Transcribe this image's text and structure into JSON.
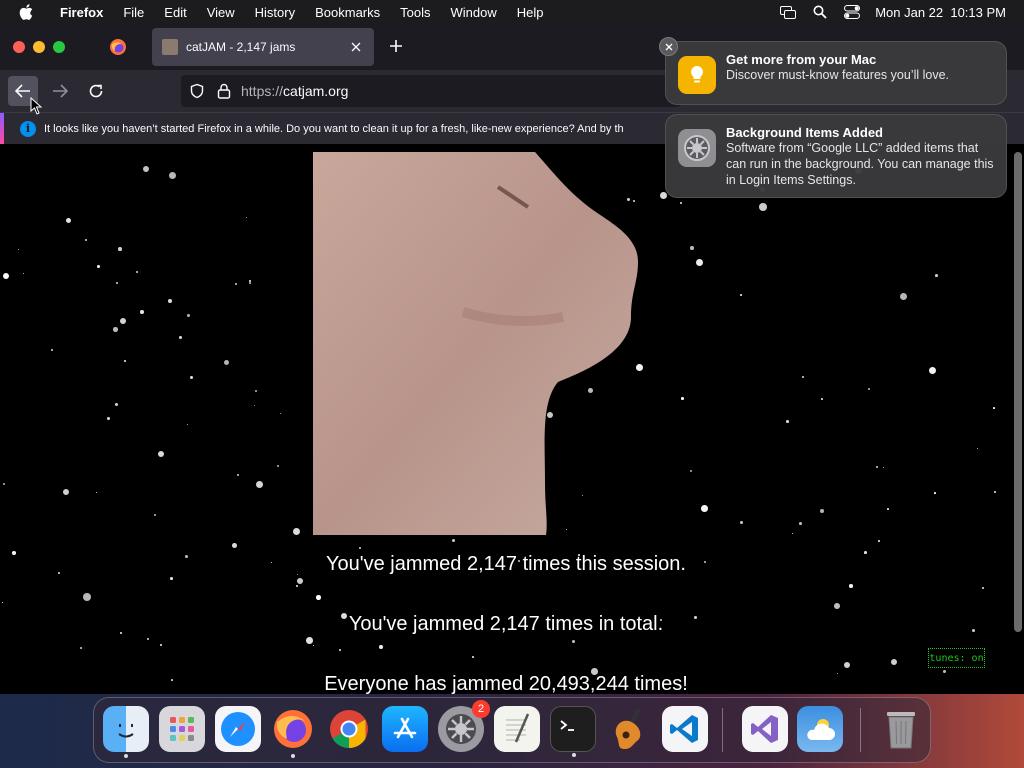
{
  "menubar": {
    "app_name": "Firefox",
    "items": [
      "File",
      "Edit",
      "View",
      "History",
      "Bookmarks",
      "Tools",
      "Window",
      "Help"
    ],
    "clock": "Mon Jan 22  10:13 PM",
    "status_icons": [
      "screen-mirroring-icon",
      "spotlight-icon",
      "control-center-icon"
    ]
  },
  "browser": {
    "tab_title": "catJAM - 2,147 jams",
    "url_scheme": "https://",
    "url_host": "catjam.org",
    "infobar_message": "It looks like you haven’t started Firefox in a while. Do you want to clean it up for a fresh, like-new experience? And by th"
  },
  "page": {
    "line_session": "You've jammed 2,147 times this session.",
    "line_total": "You've jammed 2,147 times in total.",
    "line_everyone": "Everyone has jammed 20,493,244 times!",
    "tunes_toggle": "tunes: on"
  },
  "notifications": [
    {
      "title": "Get more from your Mac",
      "body": "Discover must-know features you’ll love.",
      "icon": "tips-icon"
    },
    {
      "title": "Background Items Added",
      "body": "Software from “Google LLC” added items that can run in the background. You can manage this in Login Items Settings.",
      "icon": "system-settings-icon"
    }
  ],
  "dock": {
    "apps": [
      "Finder",
      "Launchpad",
      "Safari",
      "Firefox",
      "Google Chrome",
      "App Store",
      "System Settings",
      "TextEdit",
      "Terminal",
      "GarageBand",
      "Visual Studio Code",
      "Visual Studio",
      "Weather",
      "Trash"
    ],
    "settings_badge": "2"
  },
  "colors": {
    "accent_blue": "#0090ed",
    "tunes_green": "#1ec81e",
    "badge_red": "#ff3b30"
  }
}
